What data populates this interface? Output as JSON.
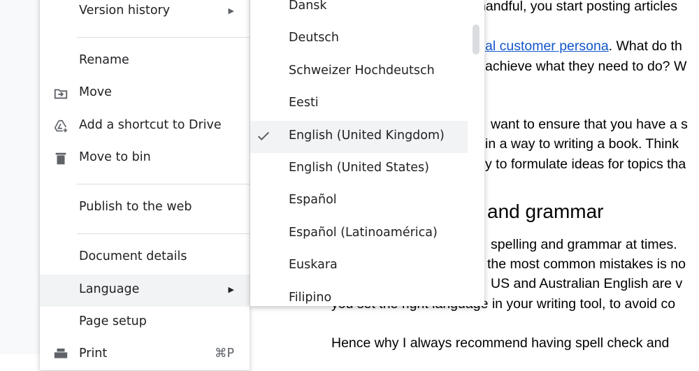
{
  "menu": {
    "items": [
      {
        "label": "Version history",
        "submenu": true
      },
      {
        "label": "Rename"
      },
      {
        "label": "Move",
        "icon": "folder-move-icon"
      },
      {
        "label": "Add a shortcut to Drive",
        "icon": "drive-shortcut-icon"
      },
      {
        "label": "Move to bin",
        "icon": "trash-icon"
      },
      {
        "label": "Publish to the web"
      },
      {
        "label": "Document details"
      },
      {
        "label": "Language",
        "submenu": true,
        "highlighted": true
      },
      {
        "label": "Page setup"
      },
      {
        "label": "Print",
        "icon": "printer-icon",
        "shortcut": "⌘P"
      }
    ]
  },
  "language_submenu": {
    "selected": "English (United Kingdom)",
    "items": [
      "Dansk",
      "Deutsch",
      "Schweizer Hochdeutsch",
      "Eesti",
      "English (United Kingdom)",
      "English (United States)",
      "Español",
      "Español (Latinoamérica)",
      "Euskara",
      "Filipino"
    ]
  },
  "document": {
    "l1": "handful, you start posting articles",
    "l2_link": "al customer persona",
    "l2_rest": ". What do th",
    "l3": "achieve what they need to do? W",
    "l4": "want to ensure that you have a s",
    "l5": "in a way to writing a book. Think",
    "l6": "y to formulate ideas for topics tha",
    "heading": "and grammar",
    "l7": "spelling and grammar at times.",
    "l8": "the most common mistakes is no",
    "l9": "US and Australian English are v",
    "l10": "you set the right language in your writing tool, to avoid co",
    "l11": "Hence why I always recommend having spell check and"
  },
  "colors": {
    "link": "#1155cc",
    "highlight": "#f1f3f4",
    "text": "#202124"
  }
}
